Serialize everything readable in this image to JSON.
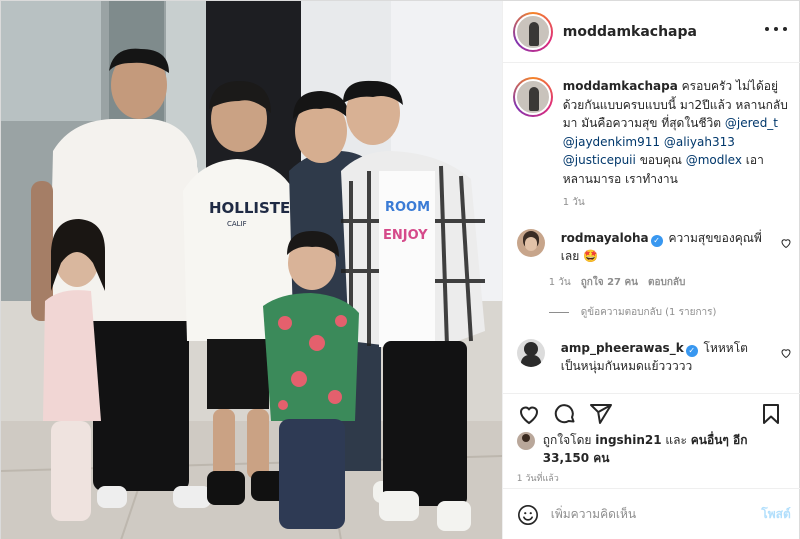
{
  "colors": {
    "accent": "#0095f6",
    "link": "#00376b",
    "muted": "#8e8e8e",
    "verified": "#3897f0",
    "like_red": "#ed4956",
    "post_disabled": "#b2dffc"
  },
  "header": {
    "username": "moddamkachapa",
    "more_icon": "more-horizontal-icon"
  },
  "photo": {
    "hoodie_text": "HOLLISTER",
    "hoodie_sub": "CALIF",
    "shirt_text_1": "ROOM",
    "shirt_text_2": "ENJOY"
  },
  "caption": {
    "username": "moddamkachapa",
    "text_1": "ครอบครัว ไม่ได้อยู่ด้วยกันแบบครบแบบนี้ มา2ปีแล้ว หลานกลับมา มันคือความสุข ที่สุดในชีวิต",
    "mention_1": "@jered_t",
    "mention_2": "@jaydenkim911",
    "mention_3": "@aliyah313",
    "mention_4": "@justicepuii",
    "text_2": "ขอบคุณ",
    "mention_5": "@modlex",
    "text_3": "เอาหลานมารอ เราทำงาน",
    "time": "1 วัน"
  },
  "comments": [
    {
      "username": "rodmayaloha",
      "text": "ความสุขของคุณพี่เลย 🤩",
      "time": "1 วัน",
      "likes": "ถูกใจ 27 คน",
      "reply": "ตอบกลับ",
      "view_replies": "ดูข้อความตอบกลับ (1 รายการ)"
    },
    {
      "username": "amp_pheerawas_k",
      "text": "โหหหโตเป็นหนุ่มกันหมดแย้ววววว"
    }
  ],
  "actions": {
    "like_icon": "heart-icon",
    "comment_icon": "comment-icon",
    "share_icon": "share-icon",
    "save_icon": "bookmark-icon"
  },
  "likes": {
    "prefix": "ถูกใจโดย",
    "user": "ingshin21",
    "connector": "และ",
    "others": "คนอื่นๆ อีก 33,150 คน"
  },
  "post_time": "1 วันที่แล้ว",
  "add_comment": {
    "placeholder": "เพิ่มความคิดเห็น",
    "post_label": "โพสต์",
    "emoji_icon": "emoji-icon"
  }
}
